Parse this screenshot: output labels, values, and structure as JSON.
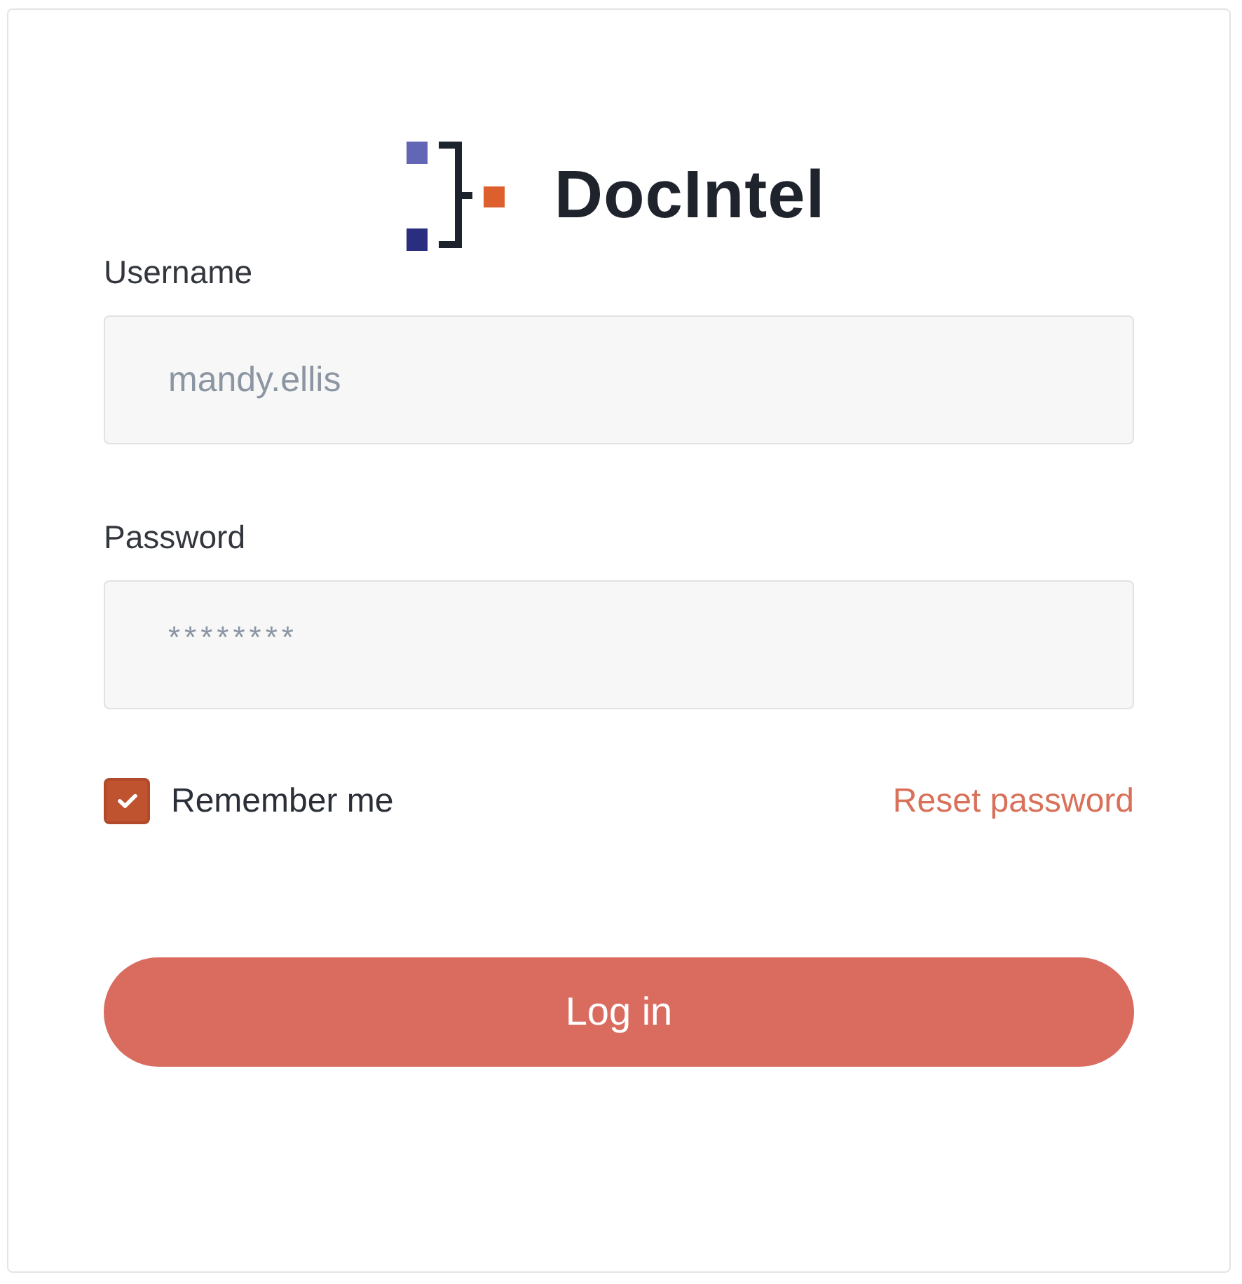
{
  "logo": {
    "name": "DocIntel"
  },
  "fields": [
    {
      "kind": "text",
      "label": "Username",
      "placeholder": "mandy.ellis"
    },
    {
      "kind": "password",
      "label": "Password",
      "placeholder": "********"
    }
  ],
  "remember": {
    "label": "Remember me",
    "checked": true
  },
  "reset_link": "Reset password",
  "submit_button": "Log in"
}
